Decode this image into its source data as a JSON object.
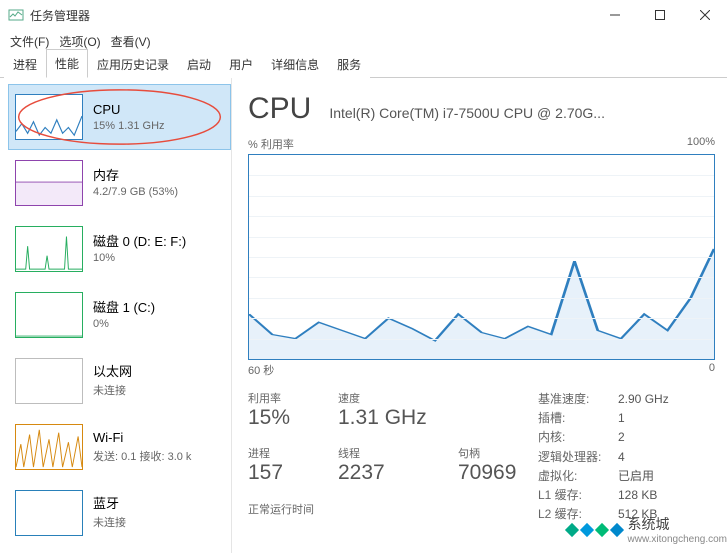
{
  "window": {
    "title": "任务管理器",
    "controls": {
      "min": "−",
      "max": "□",
      "close": "✕"
    }
  },
  "menu": {
    "file": "文件(F)",
    "options": "选项(O)",
    "view": "查看(V)"
  },
  "tabs": {
    "processes": "进程",
    "performance": "性能",
    "app_history": "应用历史记录",
    "startup": "启动",
    "users": "用户",
    "details": "详细信息",
    "services": "服务"
  },
  "sidebar": {
    "items": [
      {
        "name": "CPU",
        "sub": "15% 1.31 GHz",
        "color": "#2f7fbf"
      },
      {
        "name": "内存",
        "sub": "4.2/7.9 GB (53%)",
        "color": "#8e44ad"
      },
      {
        "name": "磁盘 0 (D: E: F:)",
        "sub": "10%",
        "color": "#27ae60"
      },
      {
        "name": "磁盘 1 (C:)",
        "sub": "0%",
        "color": "#27ae60"
      },
      {
        "name": "以太网",
        "sub": "未连接",
        "color": "#bdbdbd"
      },
      {
        "name": "Wi-Fi",
        "sub": "发送: 0.1 接收: 3.0 k",
        "color": "#d68910"
      },
      {
        "name": "蓝牙",
        "sub": "未连接",
        "color": "#2980b9"
      }
    ]
  },
  "detail": {
    "title": "CPU",
    "model": "Intel(R) Core(TM) i7-7500U CPU @ 2.70G...",
    "chart_top_left": "% 利用率",
    "chart_top_right": "100%",
    "chart_bottom_left": "60 秒",
    "chart_bottom_right": "0",
    "stats": {
      "util_lbl": "利用率",
      "util_val": "15%",
      "speed_lbl": "速度",
      "speed_val": "1.31 GHz",
      "proc_lbl": "进程",
      "proc_val": "157",
      "thread_lbl": "线程",
      "thread_val": "2237",
      "handle_lbl": "句柄",
      "handle_val": "70969",
      "uptime_lbl": "正常运行时间"
    },
    "right": {
      "base_speed_k": "基准速度:",
      "base_speed_v": "2.90 GHz",
      "sockets_k": "插槽:",
      "sockets_v": "1",
      "cores_k": "内核:",
      "cores_v": "2",
      "logical_k": "逻辑处理器:",
      "logical_v": "4",
      "virt_k": "虚拟化:",
      "virt_v": "已启用",
      "l1_k": "L1 缓存:",
      "l1_v": "128 KB",
      "l2_k": "L2 缓存:",
      "l2_v": "512 KB"
    }
  },
  "chart_data": {
    "type": "line",
    "title": "% 利用率",
    "xlabel": "60 秒 → 0",
    "ylabel": "",
    "ylim": [
      0,
      100
    ],
    "x_seconds_ago": [
      60,
      57,
      54,
      51,
      48,
      45,
      42,
      39,
      36,
      33,
      30,
      27,
      24,
      21,
      18,
      15,
      12,
      9,
      6,
      3,
      0
    ],
    "values": [
      22,
      12,
      10,
      18,
      14,
      10,
      20,
      15,
      9,
      22,
      13,
      10,
      16,
      12,
      48,
      14,
      10,
      22,
      14,
      30,
      54
    ]
  },
  "watermark": {
    "brand": "系统城",
    "url": "www.xitongcheng.com"
  }
}
